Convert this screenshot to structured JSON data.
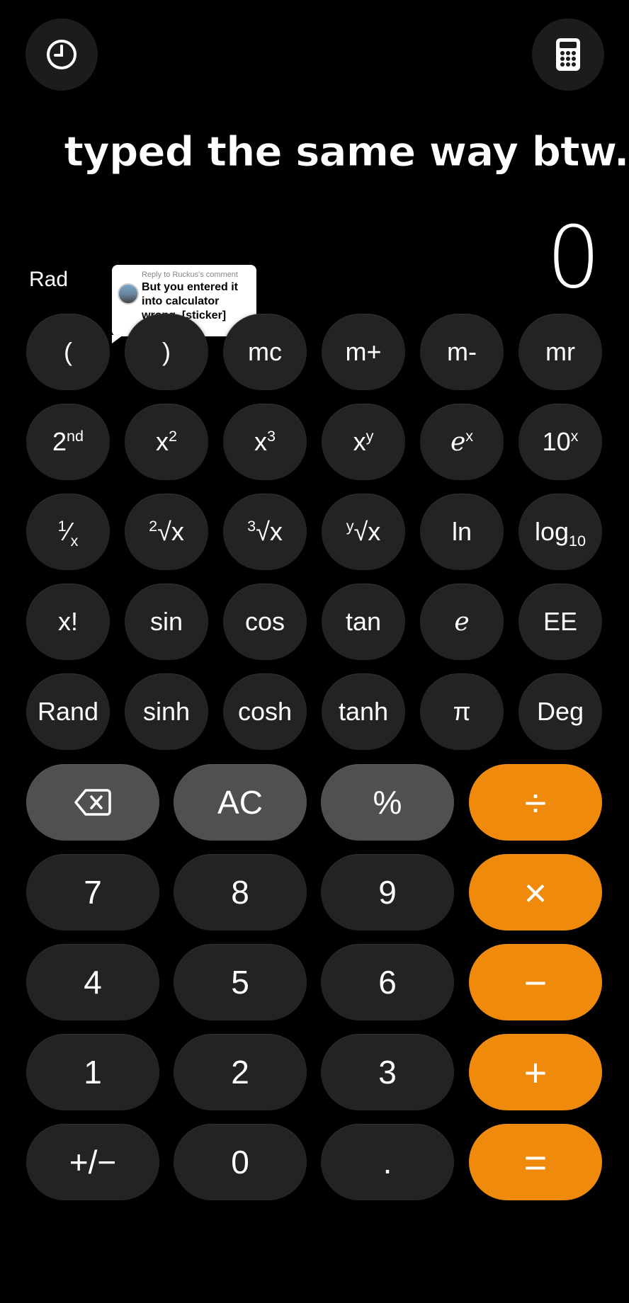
{
  "caption": "typed the same way btw.",
  "display": {
    "value": "0",
    "mode": "Rad"
  },
  "comment": {
    "reply_label": "Reply to Ruckus's comment",
    "message": "But you entered it into calculator wrong. [sticker]"
  },
  "icons": {
    "history": "clock-icon",
    "calculator": "calculator-icon",
    "backspace": "backspace-icon"
  },
  "colors": {
    "orange": "#f08a0d",
    "gray": "#505052",
    "dark": "#232325"
  },
  "sci_rows": [
    [
      "(",
      ")",
      "mc",
      "m+",
      "m-",
      "mr"
    ],
    [
      "2nd",
      "x2",
      "x3",
      "xy",
      "ex",
      "10x"
    ],
    [
      "1/x",
      "2√x",
      "3√x",
      "y√x",
      "ln",
      "log10"
    ],
    [
      "x!",
      "sin",
      "cos",
      "tan",
      "e",
      "EE"
    ],
    [
      "Rand",
      "sinh",
      "cosh",
      "tanh",
      "π",
      "Deg"
    ]
  ],
  "keys": {
    "ac": "AC",
    "percent": "%",
    "divide": "÷",
    "multiply": "×",
    "minus": "−",
    "plus": "+",
    "equals": "=",
    "seven": "7",
    "eight": "8",
    "nine": "9",
    "four": "4",
    "five": "5",
    "six": "6",
    "one": "1",
    "two": "2",
    "three": "3",
    "sign": "+/−",
    "zero": "0",
    "decimal": "."
  }
}
